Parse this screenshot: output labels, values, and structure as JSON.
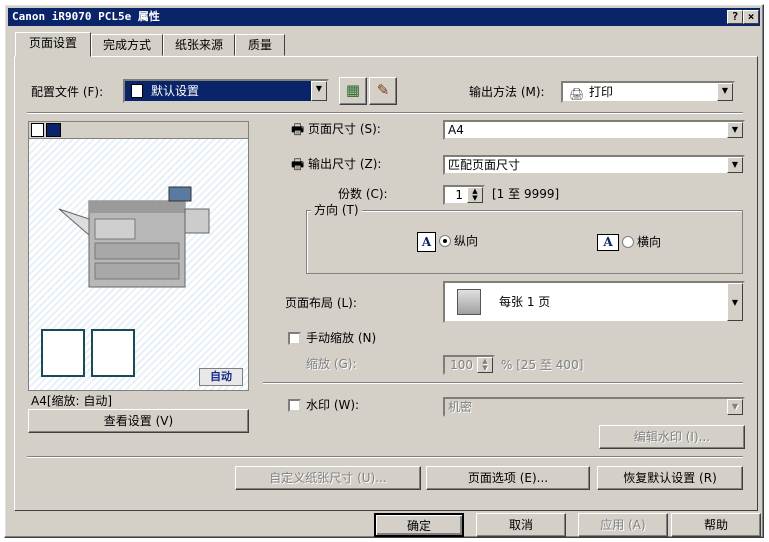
{
  "window": {
    "title": "Canon iR9070 PCL5e 属性",
    "help_btn": "?",
    "close_btn": "×"
  },
  "tabs": [
    {
      "label": "页面设置"
    },
    {
      "label": "完成方式"
    },
    {
      "label": "纸张来源"
    },
    {
      "label": "质量"
    }
  ],
  "profile": {
    "label": "配置文件 (F):",
    "value": "默认设置"
  },
  "output_method": {
    "label": "输出方法 (M):",
    "value": "打印"
  },
  "preview": {
    "caption": "A4[缩放: 自动]",
    "auto_badge": "自动",
    "view_button": "查看设置 (V)"
  },
  "page_size": {
    "label": "页面尺寸 (S):",
    "value": "A4"
  },
  "output_size": {
    "label": "输出尺寸 (Z):",
    "value": "匹配页面尺寸"
  },
  "copies": {
    "label": "份数 (C):",
    "value": "1",
    "range": "[1 至 9999]"
  },
  "orientation": {
    "legend": "方向 (T)",
    "portrait": "纵向",
    "landscape": "横向",
    "icon_letter": "A"
  },
  "layout": {
    "label": "页面布局 (L):",
    "value": "每张 1 页"
  },
  "manual_scaling": {
    "label": "手动缩放 (N)",
    "checked": false
  },
  "scaling": {
    "label": "缩放 (G):",
    "value": "100",
    "range": "% [25 至 400]"
  },
  "watermark": {
    "label": "水印 (W):",
    "value": "机密",
    "edit_button": "编辑水印 (I)...",
    "checked": false
  },
  "bottom_buttons": {
    "custom_paper": "自定义纸张尺寸 (U)...",
    "page_options": "页面选项 (E)...",
    "restore_defaults": "恢复默认设置 (R)"
  },
  "dialog_buttons": {
    "ok": "确定",
    "cancel": "取消",
    "apply": "应用 (A)",
    "help": "帮助"
  }
}
